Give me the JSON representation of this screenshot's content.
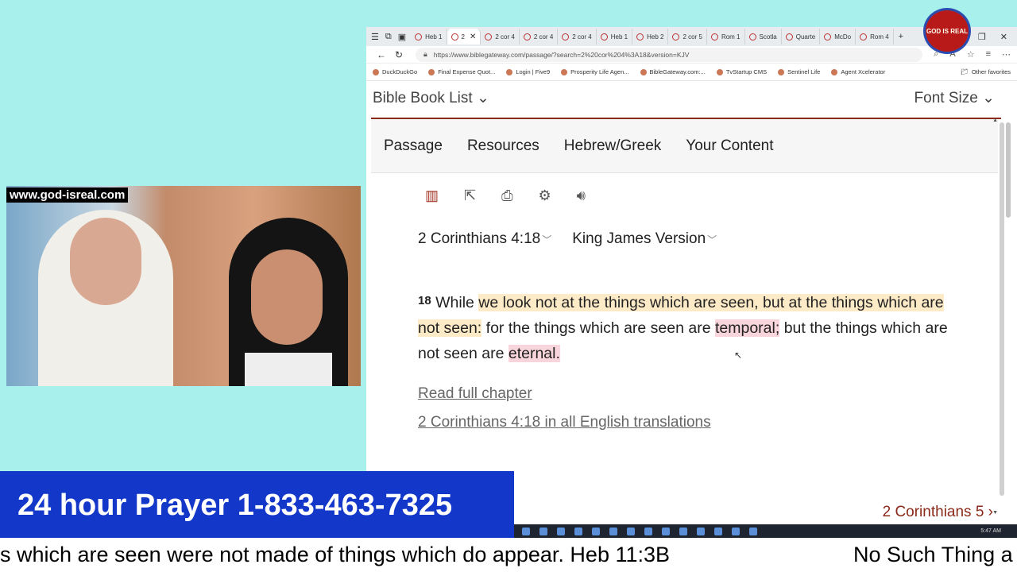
{
  "browser": {
    "tabs": [
      "Heb 1",
      "2",
      "2 cor 4",
      "2 cor 4",
      "2 cor 4",
      "Heb 1",
      "Heb 2",
      "2 cor 5",
      "Rom 1",
      "Scotla",
      "Quarte",
      "McDo",
      "Rom 4"
    ],
    "url": "https://www.biblegateway.com/passage/?search=2%20cor%204%3A18&version=KJV",
    "favorites": [
      "DuckDuckGo",
      "Final Expense Quot...",
      "Login | Five9",
      "Prosperity Life Agen...",
      "BibleGateway.com:...",
      "TvStartup CMS",
      "Sentinel Life",
      "Agent Xcelerator"
    ],
    "other_favorites": "Other favorites"
  },
  "page": {
    "book_list": "Bible Book List",
    "font_size": "Font Size",
    "nav": [
      "Passage",
      "Resources",
      "Hebrew/Greek",
      "Your Content"
    ],
    "reference": "2 Corinthians 4:18",
    "version": "King James Version",
    "verse_number": "18",
    "verse": {
      "p1": "While ",
      "p2": "we look not at the things which are seen, but at the things which are not seen:",
      "p3": " for the things which are seen are ",
      "p4": "temporal;",
      "p5": " but the things which are not seen are ",
      "p6": "eternal."
    },
    "read_full_chapter": "Read full chapter",
    "all_translations": "2 Corinthians 4:18 in all English translations",
    "next_chapter": "2 Corinthians 5"
  },
  "overlay": {
    "site_url": "www.god-isreal.com",
    "prayer_line": "24 hour Prayer 1-833-463-7325",
    "logo_text": "GOD IS REAL",
    "ticker_1": "s which are seen were not made of things which do appear. Heb 11:3B",
    "ticker_2": "No Such Thing a",
    "taskbar_time": "5:47 AM"
  },
  "icons": [
    "browser-menu-icon",
    "back-icon",
    "refresh-icon",
    "lock-icon",
    "zoom-icon",
    "read-aloud-icon",
    "favorite-icon",
    "parallel-icon",
    "share-icon",
    "print-icon",
    "settings-icon",
    "audio-icon"
  ]
}
